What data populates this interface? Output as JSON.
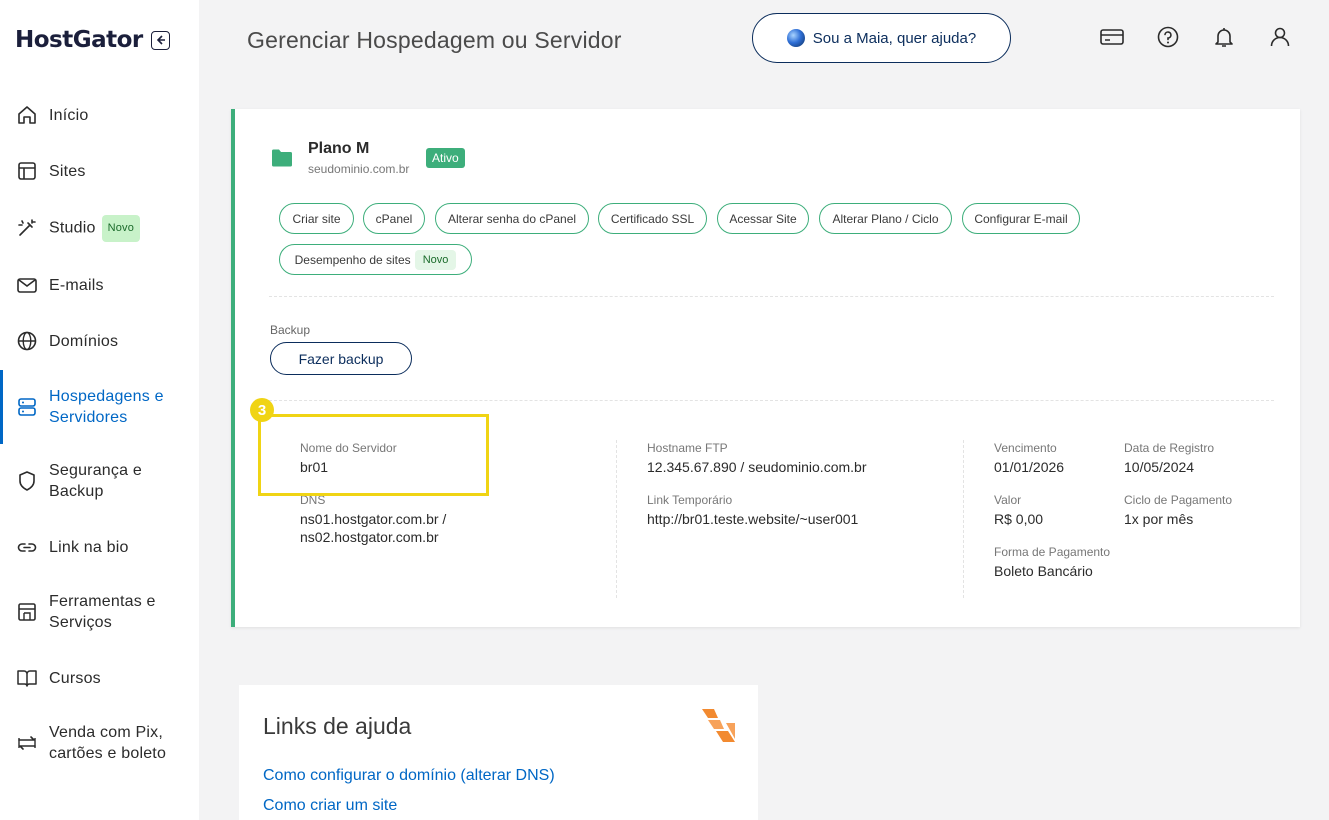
{
  "sidebar": {
    "logo": "HostGator",
    "items": [
      {
        "label": "Início"
      },
      {
        "label": "Sites"
      },
      {
        "label": "Studio",
        "badge": "Novo"
      },
      {
        "label": "E-mails"
      },
      {
        "label": "Domínios"
      },
      {
        "label_line1": "Hospedagens e",
        "label_line2": "Servidores"
      },
      {
        "label_line1": "Segurança e",
        "label_line2": "Backup"
      },
      {
        "label": "Link na bio"
      },
      {
        "label_line1": "Ferramentas e",
        "label_line2": "Serviços"
      },
      {
        "label": "Cursos"
      },
      {
        "label_line1": "Venda com Pix,",
        "label_line2": "cartões e boleto"
      }
    ]
  },
  "header": {
    "title": "Gerenciar Hospedagem ou Servidor",
    "maia_button": "Sou a Maia, quer ajuda?"
  },
  "plan": {
    "name": "Plano M",
    "domain": "seudominio.com.br",
    "status": "Ativo",
    "actions": [
      "Criar site",
      "cPanel",
      "Alterar senha do cPanel",
      "Certificado SSL",
      "Acessar Site",
      "Alterar Plano / Ciclo",
      "Configurar E-mail"
    ],
    "performance_action": "Desempenho de sites",
    "performance_badge": "Novo"
  },
  "backup": {
    "label": "Backup",
    "button": "Fazer backup"
  },
  "server_info": {
    "server_name_label": "Nome do Servidor",
    "server_name": "br01",
    "dns_label": "DNS",
    "dns_line1": "ns01.hostgator.com.br /",
    "dns_line2": "ns02.hostgator.com.br",
    "ftp_label": "Hostname FTP",
    "ftp_value": "12.345.67.890 / seudominio.com.br",
    "temp_link_label": "Link Temporário",
    "temp_link_value": "http://br01.teste.website/~user001",
    "due_label": "Vencimento",
    "due_value": "01/01/2026",
    "reg_label": "Data de Registro",
    "reg_value": "10/05/2024",
    "value_label": "Valor",
    "value_value": "R$ 0,00",
    "cycle_label": "Ciclo de Pagamento",
    "cycle_value": "1x por mês",
    "payment_label": "Forma de Pagamento",
    "payment_value": "Boleto Bancário"
  },
  "step_marker": "3",
  "help": {
    "title": "Links de ajuda",
    "links": [
      "Como configurar o domínio (alterar DNS)",
      "Como criar um site"
    ]
  },
  "colors": {
    "accent_green": "#3dae7b",
    "accent_blue": "#0067c5",
    "navy": "#0b2d5c",
    "highlight_yellow": "#f0d414",
    "help_logo_orange": "#f28a30"
  }
}
